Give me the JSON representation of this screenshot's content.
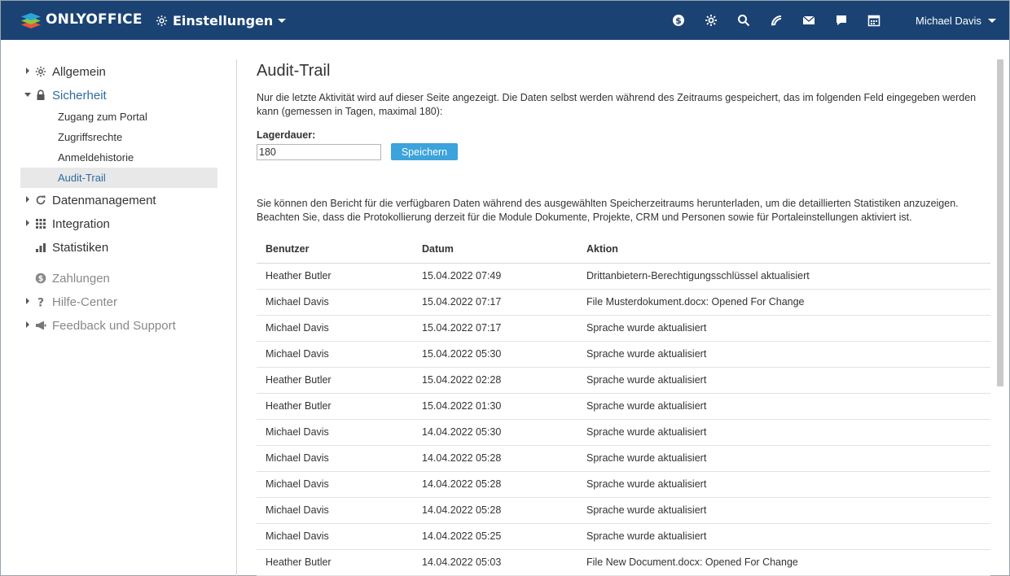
{
  "header": {
    "brand": "ONLYOFFICE",
    "module": "Einstellungen",
    "user": "Michael Davis",
    "icons": [
      "payments-icon",
      "settings-icon",
      "search-icon",
      "feed-icon",
      "mail-icon",
      "chat-icon",
      "calendar-icon"
    ]
  },
  "sidebar": {
    "items": [
      {
        "label": "Allgemein"
      },
      {
        "label": "Sicherheit"
      },
      {
        "label": "Datenmanagement"
      },
      {
        "label": "Integration"
      },
      {
        "label": "Statistiken"
      },
      {
        "label": "Zahlungen"
      },
      {
        "label": "Hilfe-Center"
      },
      {
        "label": "Feedback und Support"
      }
    ],
    "sub": [
      {
        "label": "Zugang zum Portal"
      },
      {
        "label": "Zugriffsrechte"
      },
      {
        "label": "Anmeldehistorie"
      },
      {
        "label": "Audit-Trail"
      }
    ]
  },
  "main": {
    "title": "Audit-Trail",
    "description": "Nur die letzte Aktivität wird auf dieser Seite angezeigt. Die Daten selbst werden während des Zeitraums gespeichert, das im folgenden Feld eingegeben werden kann (gemessen in Tagen, maximal 180):",
    "storage_label": "Lagerdauer:",
    "storage_value": "180",
    "save_label": "Speichern",
    "report_description": "Sie können den Bericht für die verfügbaren Daten während des ausgewählten Speicherzeitraums herunterladen, um die detaillierten Statistiken anzuzeigen. Beachten Sie, dass die Protokollierung derzeit für die Module Dokumente, Projekte, CRM und Personen sowie für Portaleinstellungen aktiviert ist.",
    "table": {
      "headers": [
        "Benutzer",
        "Datum",
        "Aktion"
      ],
      "rows": [
        [
          "Heather Butler",
          "15.04.2022 07:49",
          "Drittanbietern-Berechtigungsschlüssel aktualisiert"
        ],
        [
          "Michael Davis",
          "15.04.2022 07:17",
          "File Musterdokument.docx: Opened For Change"
        ],
        [
          "Michael Davis",
          "15.04.2022 07:17",
          "Sprache wurde aktualisiert"
        ],
        [
          "Michael Davis",
          "15.04.2022 05:30",
          "Sprache wurde aktualisiert"
        ],
        [
          "Heather Butler",
          "15.04.2022 02:28",
          "Sprache wurde aktualisiert"
        ],
        [
          "Heather Butler",
          "15.04.2022 01:30",
          "Sprache wurde aktualisiert"
        ],
        [
          "Michael Davis",
          "14.04.2022 05:30",
          "Sprache wurde aktualisiert"
        ],
        [
          "Michael Davis",
          "14.04.2022 05:28",
          "Sprache wurde aktualisiert"
        ],
        [
          "Michael Davis",
          "14.04.2022 05:28",
          "Sprache wurde aktualisiert"
        ],
        [
          "Michael Davis",
          "14.04.2022 05:28",
          "Sprache wurde aktualisiert"
        ],
        [
          "Michael Davis",
          "14.04.2022 05:25",
          "Sprache wurde aktualisiert"
        ],
        [
          "Heather Butler",
          "14.04.2022 05:03",
          "File New Document.docx: Opened For Change"
        ]
      ]
    }
  },
  "colors": {
    "header_bg": "#1a4373",
    "accent_link": "#2f6a9e",
    "button_bg": "#3ca3dc"
  }
}
